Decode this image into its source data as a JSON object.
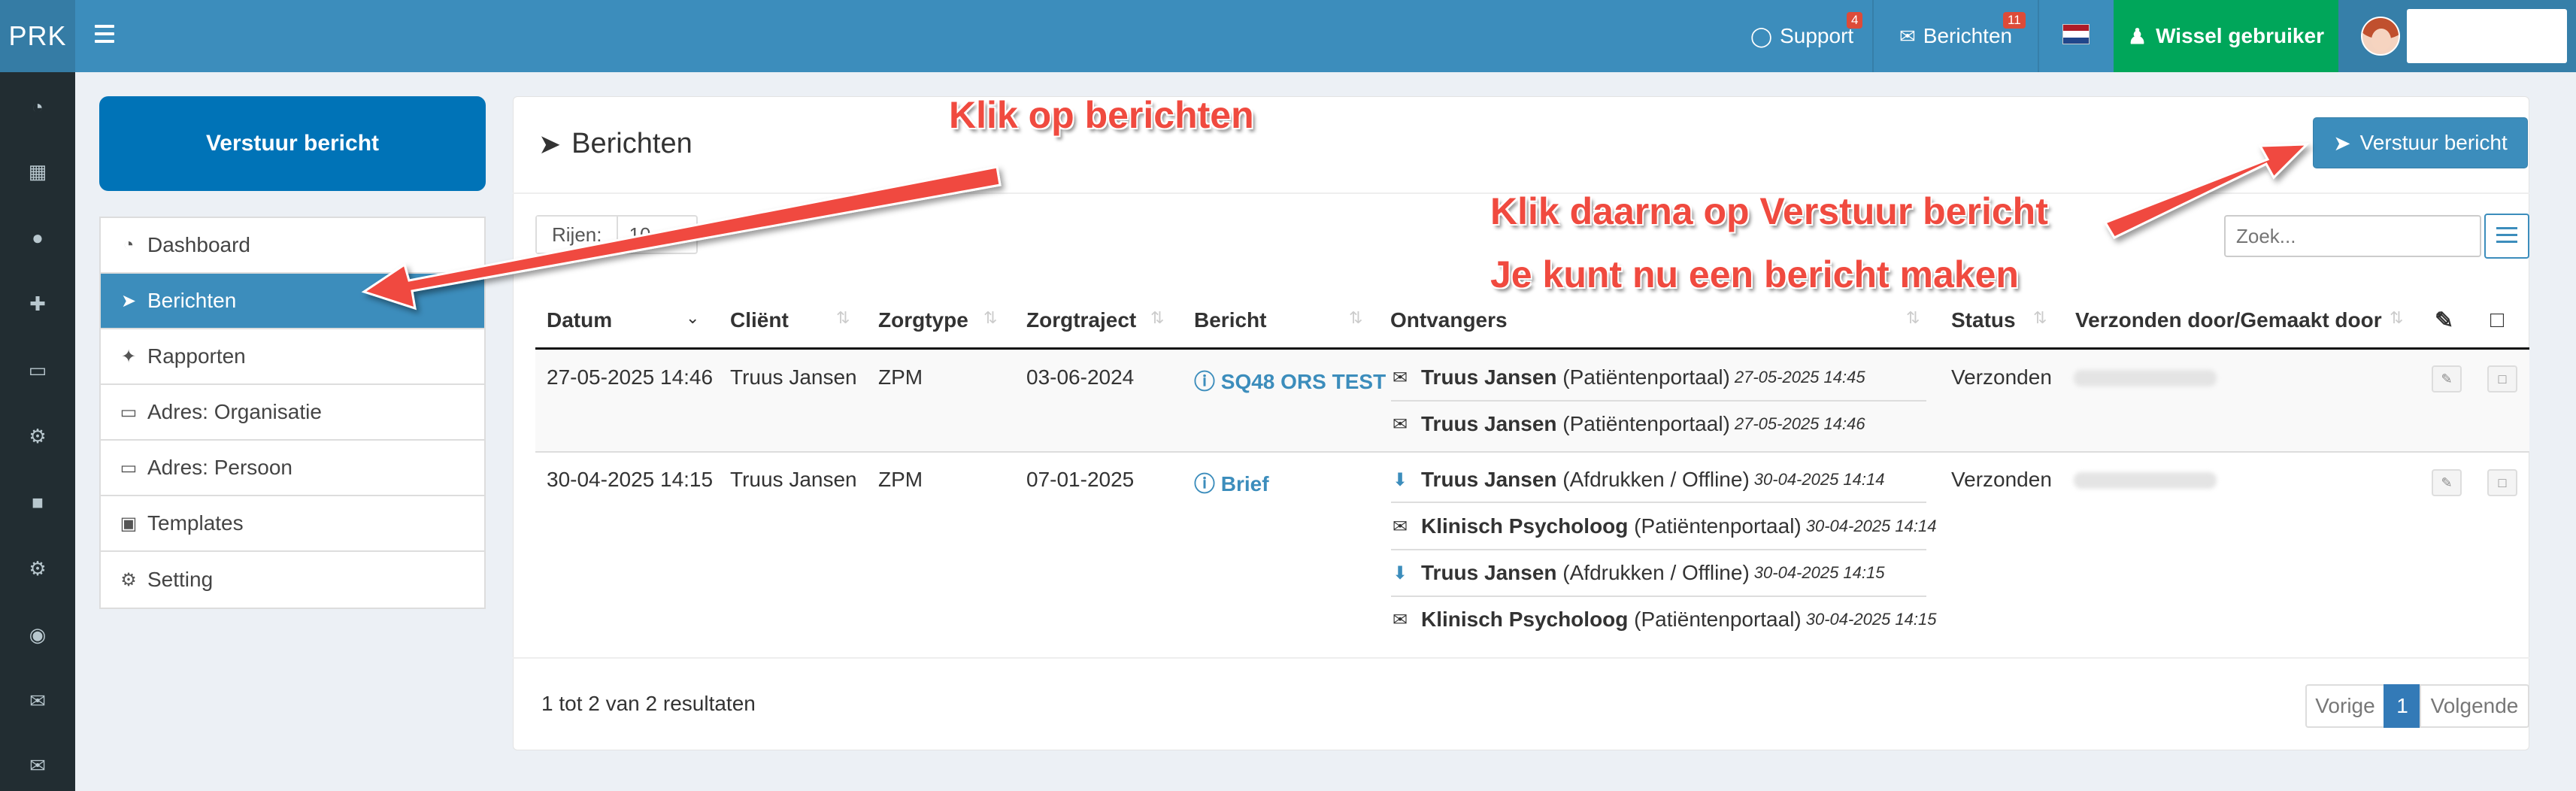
{
  "topbar": {
    "logo": "PRK",
    "support_label": "Support",
    "support_badge": "4",
    "berichten_label": "Berichten",
    "berichten_badge": "11",
    "wissel_label": "Wissel gebruiker",
    "brand_color": "#3c8dbc",
    "wissel_color": "#00a65a",
    "flag": "nl-flag"
  },
  "left": {
    "compose_button": "Verstuur bericht",
    "menu": [
      {
        "label": "Dashboard",
        "icon": "dashboard-icon"
      },
      {
        "label": "Berichten",
        "icon": "paper-plane-icon",
        "active": true
      },
      {
        "label": "Rapporten",
        "icon": "puzzle-icon"
      },
      {
        "label": "Adres: Organisatie",
        "icon": "book-icon"
      },
      {
        "label": "Adres: Persoon",
        "icon": "book-icon"
      },
      {
        "label": "Templates",
        "icon": "cubes-icon"
      },
      {
        "label": "Setting",
        "icon": "cogs-icon"
      }
    ]
  },
  "panel": {
    "title": "Berichten",
    "verstuur_button": "Verstuur bericht",
    "rows_label": "Rijen:",
    "rows_value": "10",
    "search_placeholder": "Zoek...",
    "columns": [
      "Datum",
      "Cliënt",
      "Zorgtype",
      "Zorgtraject",
      "Bericht",
      "Ontvangers",
      "Status",
      "Verzonden door/Gemaakt door"
    ],
    "rows": [
      {
        "datum": "27-05-2025 14:46",
        "client": "Truus Jansen",
        "zorgtype": "ZPM",
        "zorgtraject": "03-06-2024",
        "bericht": "SQ48 ORS TEST",
        "status": "Verzonden",
        "ontvangers": [
          {
            "name": "Truus Jansen",
            "via": "(Patiëntenportaal)",
            "time": "27-05-2025 14:45",
            "icon": "envelope-icon"
          },
          {
            "name": "Truus Jansen",
            "via": "(Patiëntenportaal)",
            "time": "27-05-2025 14:46",
            "icon": "envelope-icon"
          }
        ]
      },
      {
        "datum": "30-04-2025 14:15",
        "client": "Truus Jansen",
        "zorgtype": "ZPM",
        "zorgtraject": "07-01-2025",
        "bericht": "Brief",
        "status": "Verzonden",
        "ontvangers": [
          {
            "name": "Truus Jansen",
            "via": "(Afdrukken / Offline)",
            "time": "30-04-2025 14:14",
            "icon": "download-icon"
          },
          {
            "name": "Klinisch Psycholoog",
            "via": "(Patiëntenportaal)",
            "time": "30-04-2025 14:14",
            "icon": "envelope-icon"
          },
          {
            "name": "Truus Jansen",
            "via": "(Afdrukken / Offline)",
            "time": "30-04-2025 14:15",
            "icon": "download-icon"
          },
          {
            "name": "Klinisch Psycholoog",
            "via": "(Patiëntenportaal)",
            "time": "30-04-2025 14:15",
            "icon": "envelope-icon"
          }
        ]
      }
    ],
    "info": "1 tot 2 van 2 resultaten",
    "prev": "Vorige",
    "page": "1",
    "next": "Volgende"
  },
  "annotations": {
    "a1": "Klik op berichten",
    "a2": "Klik daarna op Verstuur bericht",
    "a3": "Je kunt nu een bericht maken",
    "color": "#f04a3f"
  }
}
